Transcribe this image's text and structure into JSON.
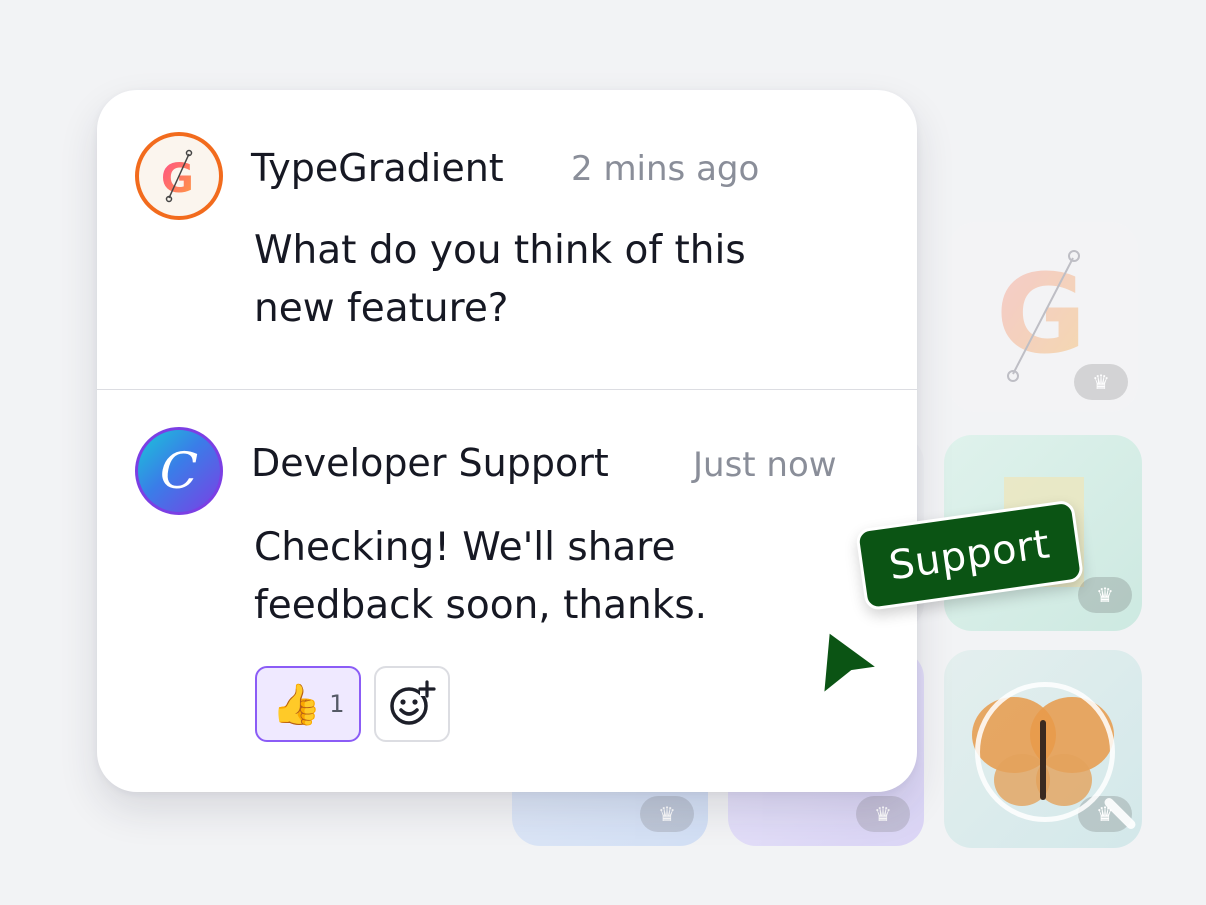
{
  "messages": [
    {
      "author": "TypeGradient",
      "time": "2 mins ago",
      "text_line1": "What do you think of this",
      "text_line2": "new feature?",
      "avatar_icon": "typegradient-logo-icon"
    },
    {
      "author": "Developer Support",
      "time": "Just now",
      "text_line1": "Checking! We'll share",
      "text_line2": "feedback soon, thanks.",
      "avatar_letter": "C",
      "reactions": [
        {
          "emoji": "👍",
          "count": "1",
          "selected": true
        }
      ]
    }
  ],
  "cursor_tag": {
    "label": "Support",
    "color": "#0b5414"
  },
  "colors": {
    "accent_purple": "#8b5cf6",
    "typegradient_orange": "#f26b1d"
  }
}
